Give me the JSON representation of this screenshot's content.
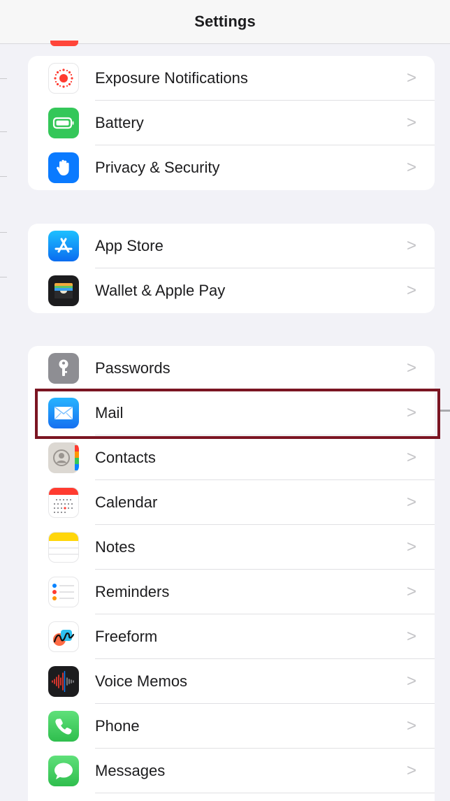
{
  "header": {
    "title": "Settings"
  },
  "groups": [
    {
      "items": [
        {
          "label": "Exposure Notifications",
          "icon": "exposure-icon",
          "color": "#ffffff"
        },
        {
          "label": "Battery",
          "icon": "battery-icon",
          "color": "#34c759"
        },
        {
          "label": "Privacy & Security",
          "icon": "hand-icon",
          "color": "#0a7aff"
        }
      ]
    },
    {
      "items": [
        {
          "label": "App Store",
          "icon": "app-store-icon",
          "color": "#1a8cff"
        },
        {
          "label": "Wallet & Apple Pay",
          "icon": "wallet-icon",
          "color": "#1c1c1e"
        }
      ]
    },
    {
      "items": [
        {
          "label": "Passwords",
          "icon": "key-icon",
          "color": "#8e8e93"
        },
        {
          "label": "Mail",
          "icon": "mail-icon",
          "color": "#1f8fff",
          "highlighted": true
        },
        {
          "label": "Contacts",
          "icon": "contacts-icon",
          "color": "#d9d6d1"
        },
        {
          "label": "Calendar",
          "icon": "calendar-icon",
          "color": "#ffffff"
        },
        {
          "label": "Notes",
          "icon": "notes-icon",
          "color": "#ffffff"
        },
        {
          "label": "Reminders",
          "icon": "reminders-icon",
          "color": "#ffffff"
        },
        {
          "label": "Freeform",
          "icon": "freeform-icon",
          "color": "#ffffff"
        },
        {
          "label": "Voice Memos",
          "icon": "voice-memos-icon",
          "color": "#1c1c1e"
        },
        {
          "label": "Phone",
          "icon": "phone-icon",
          "color": "#34c759"
        },
        {
          "label": "Messages",
          "icon": "messages-icon",
          "color": "#34c759"
        }
      ]
    }
  ],
  "chevron_glyph": ">",
  "highlight_color": "#7b1522"
}
